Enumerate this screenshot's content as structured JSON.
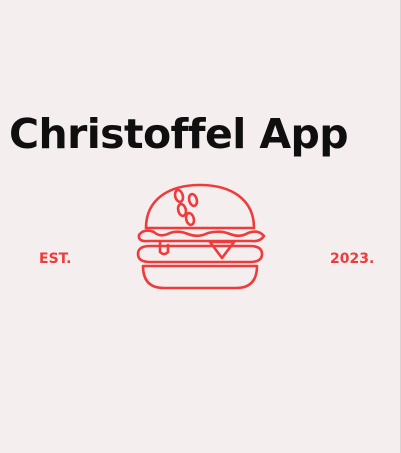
{
  "title": "Christoffel App",
  "est_label": "EST.",
  "year_label": "2023.",
  "logo_icon": "burger-icon",
  "colors": {
    "background": "#f4eeee",
    "title": "#0f0f0f",
    "accent": "#ee3b3b"
  }
}
